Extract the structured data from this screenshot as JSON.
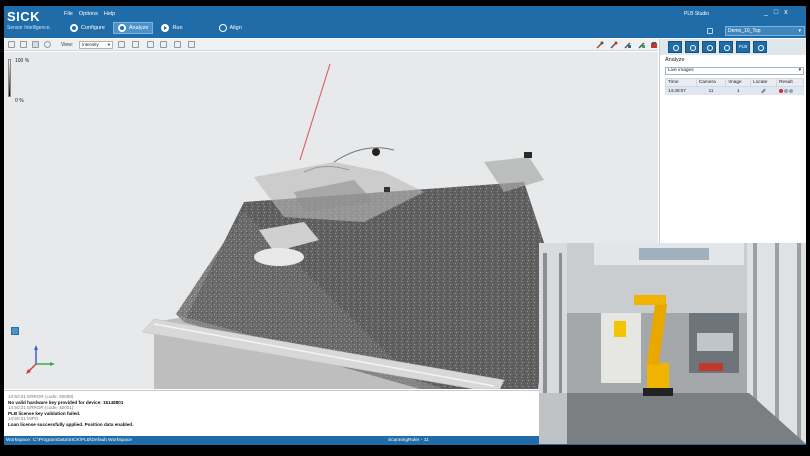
{
  "app": {
    "brand": "SICK",
    "tagline": "Sensor Intelligence.",
    "window_title": "PLB Studio",
    "menu": [
      "File",
      "Options",
      "Help"
    ],
    "window_controls": [
      "_",
      "□",
      "x"
    ],
    "modes": [
      {
        "label": "Configure",
        "icon": "gear-icon",
        "active": false
      },
      {
        "label": "Analyze",
        "icon": "analyze-icon",
        "active": true
      },
      {
        "label": "Run",
        "icon": "play-icon",
        "active": false
      },
      {
        "label": "Align",
        "icon": "align-icon",
        "active": false
      }
    ],
    "project": "Demo_10_Top"
  },
  "toolbar": {
    "view_label": "View:",
    "view_value": "Intensity"
  },
  "viewport": {
    "legend_max": "100 %",
    "legend_min": "0 %",
    "axis_colors": {
      "x": "#d43a3a",
      "y": "#34b04a",
      "z": "#3a5fd4"
    }
  },
  "analyze_panel": {
    "title": "Analyze",
    "filter": "Live images",
    "columns": [
      "Time",
      "Camera",
      "Image",
      "Locate",
      "Result"
    ],
    "rows": [
      {
        "time": "14:48:07",
        "camera": "11",
        "image": "1"
      }
    ]
  },
  "log": [
    {
      "kind": "meta",
      "text": "14:50:31 ERROR (code: 40008)"
    },
    {
      "kind": "msg",
      "text": "No valid hardware key provided for device: 15148801"
    },
    {
      "kind": "meta",
      "text": "14:50:31 ERROR (code: 40001)"
    },
    {
      "kind": "msg",
      "text": "PLB license key validation failed."
    },
    {
      "kind": "meta",
      "text": "14:50:31 INFO"
    },
    {
      "kind": "msg",
      "text": "Loan license successfully applied. Position data enabled."
    }
  ],
  "status": {
    "workspace": "Workspace: C:\\ProgramData\\SICK\\PLB\\Default Workspace",
    "scanning": "ScanningRuler - 11"
  }
}
